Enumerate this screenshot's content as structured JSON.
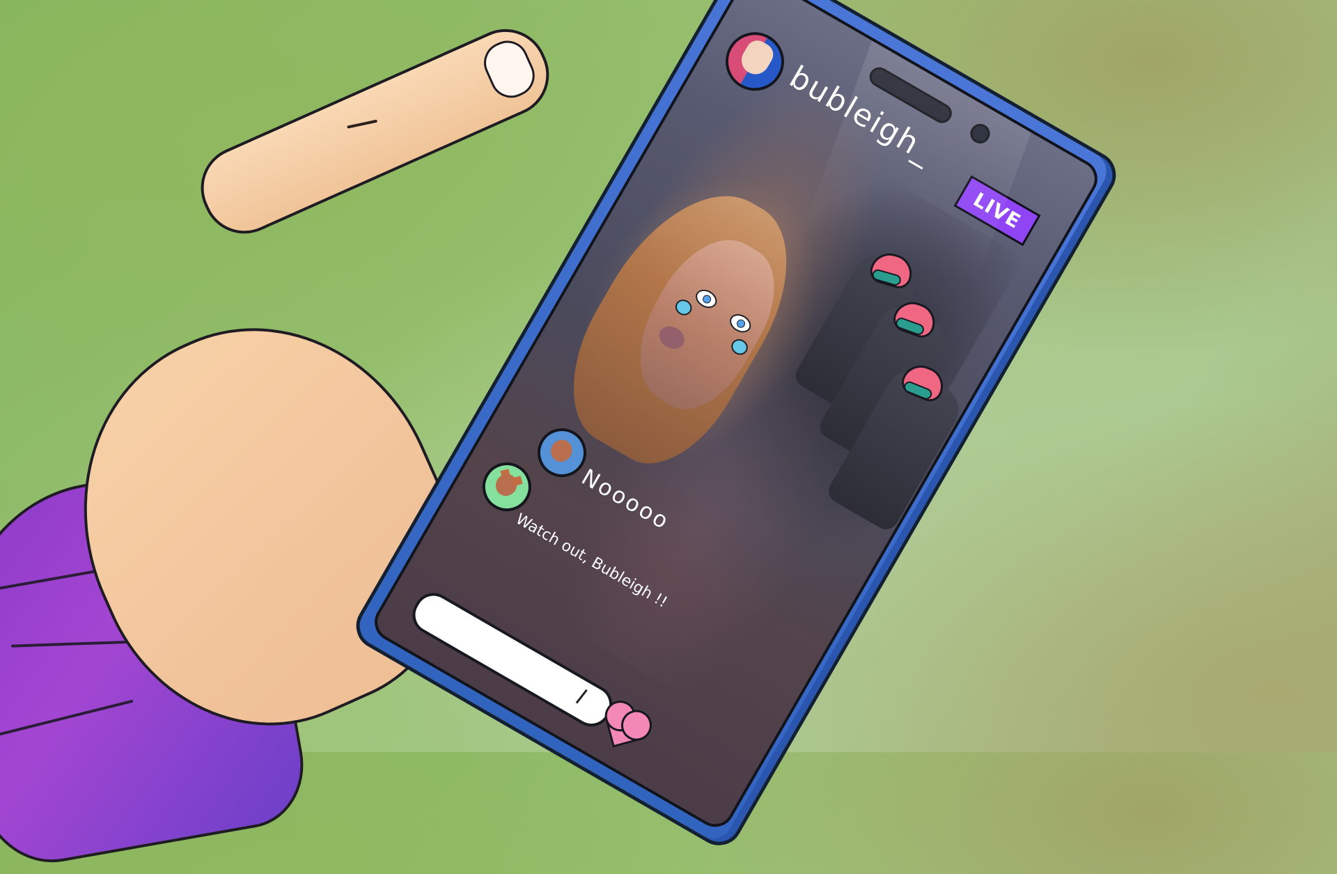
{
  "stream": {
    "username": "bubleigh_",
    "live_label": "LIVE",
    "comments": [
      {
        "text": "Nooooo"
      },
      {
        "text": "Watch out, Bubleigh !!"
      }
    ]
  },
  "icons": {
    "profile": "avatar-icon",
    "comment_1": "avatar-icon",
    "comment_2": "cat-avatar-icon",
    "like": "heart-icon"
  },
  "colors": {
    "live_badge": "#8f45f4",
    "phone_frame": "#3164bf",
    "heart": "#f387b6",
    "sleeve": "#8b39c8",
    "background": "#9cc477"
  }
}
